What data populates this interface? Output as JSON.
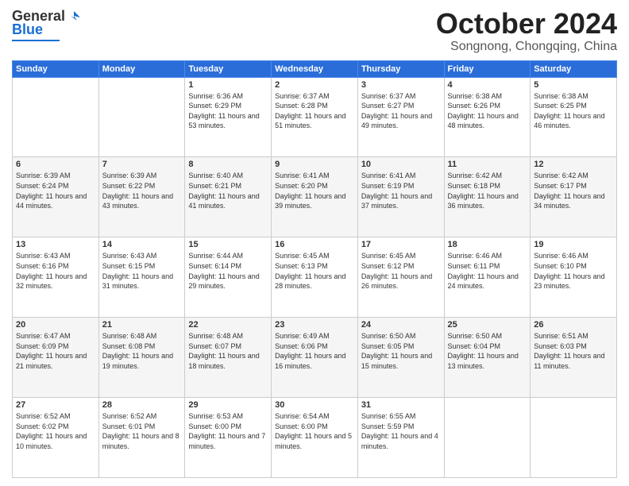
{
  "header": {
    "logo": {
      "line1": "General",
      "line2": "Blue"
    },
    "title": "October 2024",
    "subtitle": "Songnong, Chongqing, China"
  },
  "weekdays": [
    "Sunday",
    "Monday",
    "Tuesday",
    "Wednesday",
    "Thursday",
    "Friday",
    "Saturday"
  ],
  "weeks": [
    [
      {
        "day": "",
        "info": ""
      },
      {
        "day": "",
        "info": ""
      },
      {
        "day": "1",
        "info": "Sunrise: 6:36 AM\nSunset: 6:29 PM\nDaylight: 11 hours and 53 minutes."
      },
      {
        "day": "2",
        "info": "Sunrise: 6:37 AM\nSunset: 6:28 PM\nDaylight: 11 hours and 51 minutes."
      },
      {
        "day": "3",
        "info": "Sunrise: 6:37 AM\nSunset: 6:27 PM\nDaylight: 11 hours and 49 minutes."
      },
      {
        "day": "4",
        "info": "Sunrise: 6:38 AM\nSunset: 6:26 PM\nDaylight: 11 hours and 48 minutes."
      },
      {
        "day": "5",
        "info": "Sunrise: 6:38 AM\nSunset: 6:25 PM\nDaylight: 11 hours and 46 minutes."
      }
    ],
    [
      {
        "day": "6",
        "info": "Sunrise: 6:39 AM\nSunset: 6:24 PM\nDaylight: 11 hours and 44 minutes."
      },
      {
        "day": "7",
        "info": "Sunrise: 6:39 AM\nSunset: 6:22 PM\nDaylight: 11 hours and 43 minutes."
      },
      {
        "day": "8",
        "info": "Sunrise: 6:40 AM\nSunset: 6:21 PM\nDaylight: 11 hours and 41 minutes."
      },
      {
        "day": "9",
        "info": "Sunrise: 6:41 AM\nSunset: 6:20 PM\nDaylight: 11 hours and 39 minutes."
      },
      {
        "day": "10",
        "info": "Sunrise: 6:41 AM\nSunset: 6:19 PM\nDaylight: 11 hours and 37 minutes."
      },
      {
        "day": "11",
        "info": "Sunrise: 6:42 AM\nSunset: 6:18 PM\nDaylight: 11 hours and 36 minutes."
      },
      {
        "day": "12",
        "info": "Sunrise: 6:42 AM\nSunset: 6:17 PM\nDaylight: 11 hours and 34 minutes."
      }
    ],
    [
      {
        "day": "13",
        "info": "Sunrise: 6:43 AM\nSunset: 6:16 PM\nDaylight: 11 hours and 32 minutes."
      },
      {
        "day": "14",
        "info": "Sunrise: 6:43 AM\nSunset: 6:15 PM\nDaylight: 11 hours and 31 minutes."
      },
      {
        "day": "15",
        "info": "Sunrise: 6:44 AM\nSunset: 6:14 PM\nDaylight: 11 hours and 29 minutes."
      },
      {
        "day": "16",
        "info": "Sunrise: 6:45 AM\nSunset: 6:13 PM\nDaylight: 11 hours and 28 minutes."
      },
      {
        "day": "17",
        "info": "Sunrise: 6:45 AM\nSunset: 6:12 PM\nDaylight: 11 hours and 26 minutes."
      },
      {
        "day": "18",
        "info": "Sunrise: 6:46 AM\nSunset: 6:11 PM\nDaylight: 11 hours and 24 minutes."
      },
      {
        "day": "19",
        "info": "Sunrise: 6:46 AM\nSunset: 6:10 PM\nDaylight: 11 hours and 23 minutes."
      }
    ],
    [
      {
        "day": "20",
        "info": "Sunrise: 6:47 AM\nSunset: 6:09 PM\nDaylight: 11 hours and 21 minutes."
      },
      {
        "day": "21",
        "info": "Sunrise: 6:48 AM\nSunset: 6:08 PM\nDaylight: 11 hours and 19 minutes."
      },
      {
        "day": "22",
        "info": "Sunrise: 6:48 AM\nSunset: 6:07 PM\nDaylight: 11 hours and 18 minutes."
      },
      {
        "day": "23",
        "info": "Sunrise: 6:49 AM\nSunset: 6:06 PM\nDaylight: 11 hours and 16 minutes."
      },
      {
        "day": "24",
        "info": "Sunrise: 6:50 AM\nSunset: 6:05 PM\nDaylight: 11 hours and 15 minutes."
      },
      {
        "day": "25",
        "info": "Sunrise: 6:50 AM\nSunset: 6:04 PM\nDaylight: 11 hours and 13 minutes."
      },
      {
        "day": "26",
        "info": "Sunrise: 6:51 AM\nSunset: 6:03 PM\nDaylight: 11 hours and 11 minutes."
      }
    ],
    [
      {
        "day": "27",
        "info": "Sunrise: 6:52 AM\nSunset: 6:02 PM\nDaylight: 11 hours and 10 minutes."
      },
      {
        "day": "28",
        "info": "Sunrise: 6:52 AM\nSunset: 6:01 PM\nDaylight: 11 hours and 8 minutes."
      },
      {
        "day": "29",
        "info": "Sunrise: 6:53 AM\nSunset: 6:00 PM\nDaylight: 11 hours and 7 minutes."
      },
      {
        "day": "30",
        "info": "Sunrise: 6:54 AM\nSunset: 6:00 PM\nDaylight: 11 hours and 5 minutes."
      },
      {
        "day": "31",
        "info": "Sunrise: 6:55 AM\nSunset: 5:59 PM\nDaylight: 11 hours and 4 minutes."
      },
      {
        "day": "",
        "info": ""
      },
      {
        "day": "",
        "info": ""
      }
    ]
  ]
}
